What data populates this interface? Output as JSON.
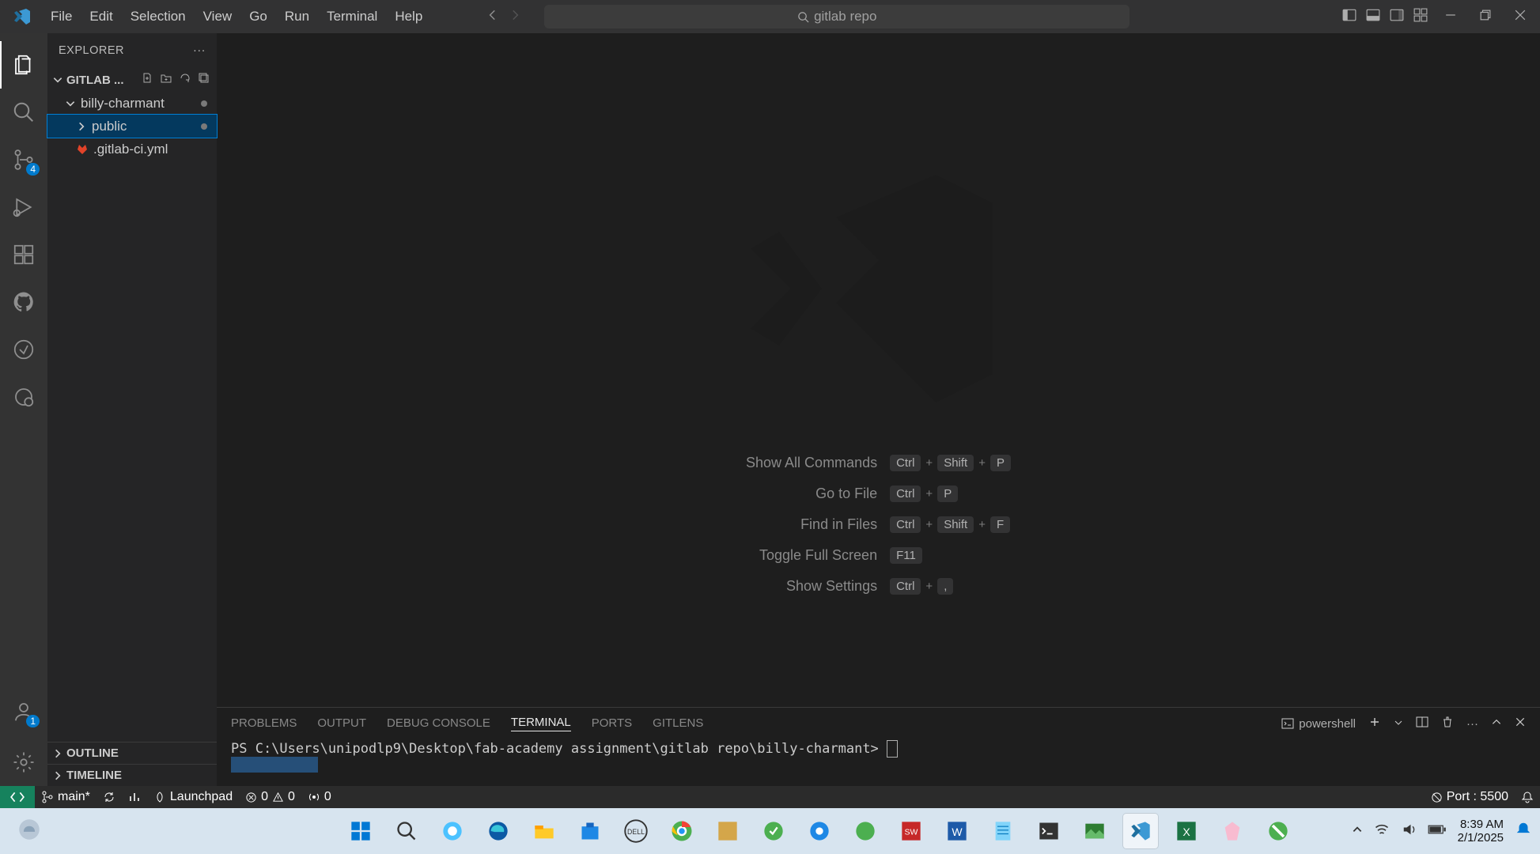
{
  "menu": {
    "file": "File",
    "edit": "Edit",
    "selection": "Selection",
    "view": "View",
    "go": "Go",
    "run": "Run",
    "terminal": "Terminal",
    "help": "Help"
  },
  "search": {
    "text": "gitlab repo"
  },
  "activity": {
    "source_control_badge": "4",
    "accounts_badge": "1"
  },
  "sidebar": {
    "title": "EXPLORER",
    "workspace": "GITLAB ...",
    "folder1": "billy-charmant",
    "folder2": "public",
    "file1": ".gitlab-ci.yml",
    "outline": "OUTLINE",
    "timeline": "TIMELINE"
  },
  "welcome": {
    "cmd1": "Show All Commands",
    "cmd2": "Go to File",
    "cmd3": "Find in Files",
    "cmd4": "Toggle Full Screen",
    "cmd5": "Show Settings",
    "ctrl": "Ctrl",
    "shift": "Shift",
    "p": "P",
    "f": "F",
    "f11": "F11",
    "comma": ","
  },
  "panel": {
    "tabs": {
      "problems": "PROBLEMS",
      "output": "OUTPUT",
      "debug": "DEBUG CONSOLE",
      "terminal": "TERMINAL",
      "ports": "PORTS",
      "gitlens": "GITLENS"
    },
    "termtype": "powershell",
    "prompt": "PS C:\\Users\\unipodlp9\\Desktop\\fab-academy assignment\\gitlab repo\\billy-charmant>"
  },
  "status": {
    "branch": "main*",
    "launchpad": "Launchpad",
    "errors": "0",
    "warnings": "0",
    "ports_num": "0",
    "port_label": "Port : 5500"
  },
  "systray": {
    "time": "8:39 AM",
    "date": "2/1/2025"
  }
}
